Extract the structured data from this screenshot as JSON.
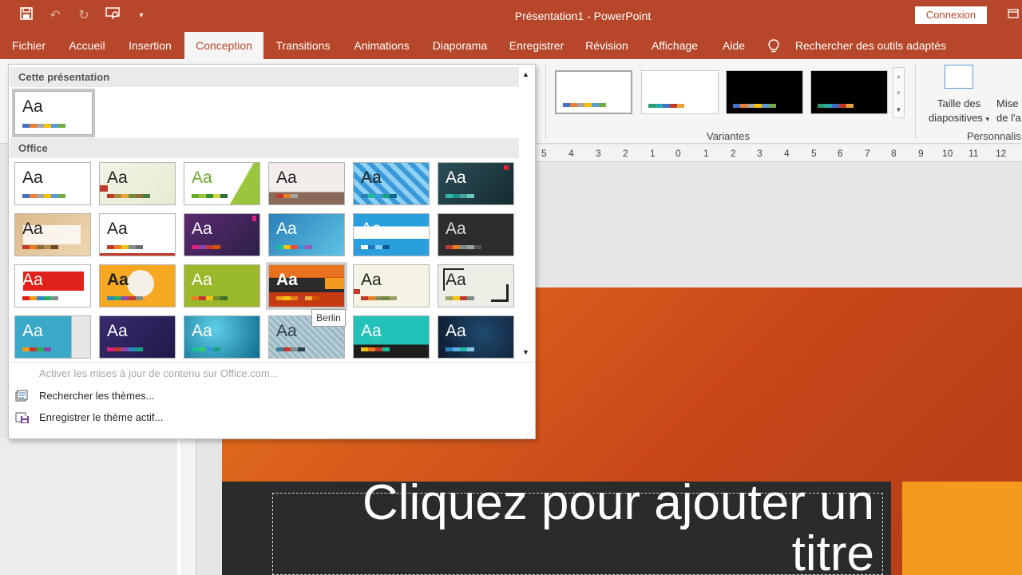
{
  "titlebar": {
    "title": "Présentation1  -  PowerPoint",
    "connexion": "Connexion",
    "qat_icons": [
      "save-icon",
      "undo-icon",
      "redo-icon",
      "present-icon",
      "customize-icon"
    ]
  },
  "tabs": [
    {
      "label": "Fichier"
    },
    {
      "label": "Accueil"
    },
    {
      "label": "Insertion"
    },
    {
      "label": "Conception",
      "active": true
    },
    {
      "label": "Transitions"
    },
    {
      "label": "Animations"
    },
    {
      "label": "Diaporama"
    },
    {
      "label": "Enregistrer"
    },
    {
      "label": "Révision"
    },
    {
      "label": "Affichage"
    },
    {
      "label": "Aide"
    }
  ],
  "search_tab": "Rechercher des outils adaptés",
  "ribbon": {
    "variants_label": "Variantes",
    "personnaliser_label": "Personnalis",
    "size_button": "Taille des diapositives",
    "size_line1": "Taille des",
    "size_line2": "diapositives",
    "mise_line1": "Mise",
    "mise_line2": "de l'a"
  },
  "gallery": {
    "section_current": "Cette présentation",
    "section_office": "Office",
    "aa": "Aa",
    "tooltip": "Berlin",
    "menu": {
      "update": "Activer les mises à jour de contenu sur Office.com...",
      "browse": "Rechercher les thèmes...",
      "save": "Enregistrer le thème actif..."
    }
  },
  "ruler_numbers": [
    "5",
    "4",
    "3",
    "2",
    "1",
    "0",
    "1",
    "2",
    "3",
    "4",
    "5",
    "6",
    "7",
    "8",
    "9",
    "10",
    "11",
    "12"
  ],
  "slide": {
    "title_placeholder": "Cliquez pour ajouter un titre"
  },
  "colors": {
    "accent": "#b7472a",
    "slide_orange": "#e8721d",
    "slide_dark": "#2b2b2b"
  }
}
